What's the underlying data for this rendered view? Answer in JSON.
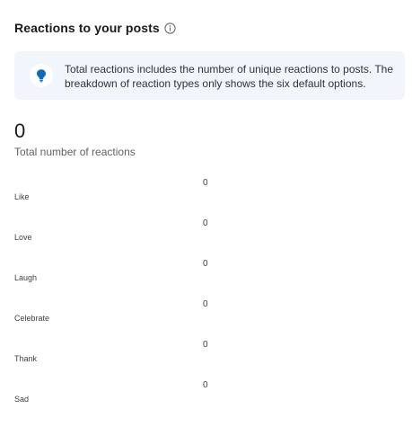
{
  "header": {
    "title": "Reactions to your posts",
    "info_icon": "info-circle-icon"
  },
  "info_card": {
    "icon": "lightbulb-icon",
    "accent_color": "#0f6cbd",
    "background_color": "#f0f6fc",
    "text": "Total reactions includes the number of unique reactions to posts. The breakdown of reaction types only shows the six default options."
  },
  "summary": {
    "total_value": "0",
    "total_label": "Total number of reactions"
  },
  "reactions": [
    {
      "label": "Like",
      "count": "0"
    },
    {
      "label": "Love",
      "count": "0"
    },
    {
      "label": "Laugh",
      "count": "0"
    },
    {
      "label": "Celebrate",
      "count": "0"
    },
    {
      "label": "Thank",
      "count": "0"
    },
    {
      "label": "Sad",
      "count": "0"
    }
  ]
}
